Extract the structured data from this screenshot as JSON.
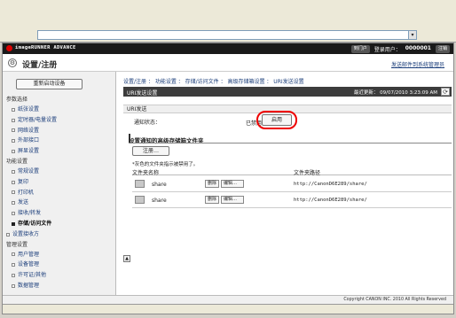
{
  "browser": {
    "dropdown_icon": "▾"
  },
  "brand": {
    "name": "imageRUNNER ADVANCE",
    "portal": "到门户",
    "login_label": "登录用户：",
    "user": "0000001",
    "logout": "注销"
  },
  "header": {
    "title": "设置/注册",
    "link": "发送邮件到系统管理员",
    "icon": "gear-icon",
    "icon_glyph": "⚙"
  },
  "sidebar": {
    "restart": "重新启动设备",
    "groups": [
      {
        "label": "参数选择",
        "items": [
          "纸张设置",
          "定时器/电量设置",
          "网络设置",
          "外部接口",
          "屏显设置"
        ]
      },
      {
        "label": "功能设置",
        "items": [
          "常规设置",
          "复印",
          "打印机",
          "发送",
          "接收/转发",
          "存储/访问文件"
        ]
      },
      {
        "label": "设置接收方",
        "items": []
      },
      {
        "label": "管理设置",
        "items": [
          "用户管理",
          "设备管理",
          "许可证/其他",
          "数据管理"
        ]
      }
    ],
    "active_item": "存储/访问文件"
  },
  "main": {
    "breadcrumb": "设置/注册 ： 功能设置 ： 存储/访问文件 ： 高级存储箱设置 ： URI发送设置",
    "section_title": "URI发送设置",
    "last_updated": "最近更新： 09/07/2010 3:23:09 AM",
    "refresh_icon": "⟳",
    "sub_title": "URI发送",
    "notify_label": "通知状态：",
    "notify_value": "已禁用",
    "enable_button": "启用",
    "list_title": "设置通知的高级存储箱文件夹",
    "register_button": "注册…",
    "note": "*灰色的文件夹指示被禁用了。",
    "col_name": "文件夹名称",
    "col_path": "文件夹路径",
    "rows": [
      {
        "name": "share",
        "delete": "删除",
        "edit": "编辑…",
        "path": "http://CanonD6E289/share/"
      },
      {
        "name": "share",
        "delete": "删除",
        "edit": "编辑…",
        "path": "http://CanonD6E289/share/"
      }
    ],
    "scroll_icon": "▲"
  },
  "footer": {
    "copyright": "Copyright CANON INC. 2010 All Rights Reserved"
  }
}
